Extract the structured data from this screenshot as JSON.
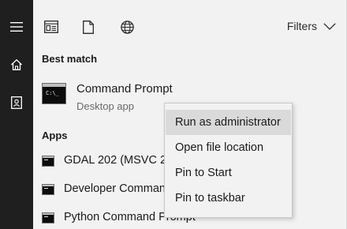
{
  "toolbar": {
    "filters_label": "Filters",
    "icons": [
      "document-preview-icon",
      "file-icon",
      "globe-icon"
    ]
  },
  "rail": {
    "icons": [
      "hamburger-menu-icon",
      "home-icon",
      "profile-icon"
    ]
  },
  "best_match": {
    "heading": "Best match",
    "title": "Command Prompt",
    "subtitle": "Desktop app",
    "icon": "command-prompt-icon",
    "icon_text": "C:\\_"
  },
  "apps": {
    "heading": "Apps",
    "items": [
      {
        "label": "GDAL 202 (MSVC 2",
        "icon": "command-prompt-icon"
      },
      {
        "label": "Developer Comman",
        "icon": "command-prompt-icon"
      },
      {
        "label": "Python Command Prompt",
        "icon": "command-prompt-icon"
      }
    ]
  },
  "context_menu": {
    "items": [
      {
        "label": "Run as administrator",
        "highlighted": true
      },
      {
        "label": "Open file location",
        "highlighted": false
      },
      {
        "label": "Pin to Start",
        "highlighted": false
      },
      {
        "label": "Pin to taskbar",
        "highlighted": false
      }
    ]
  },
  "colors": {
    "rail_background": "#1f1f1f",
    "panel_background": "#f2f2f2",
    "menu_highlight": "#dadada"
  }
}
